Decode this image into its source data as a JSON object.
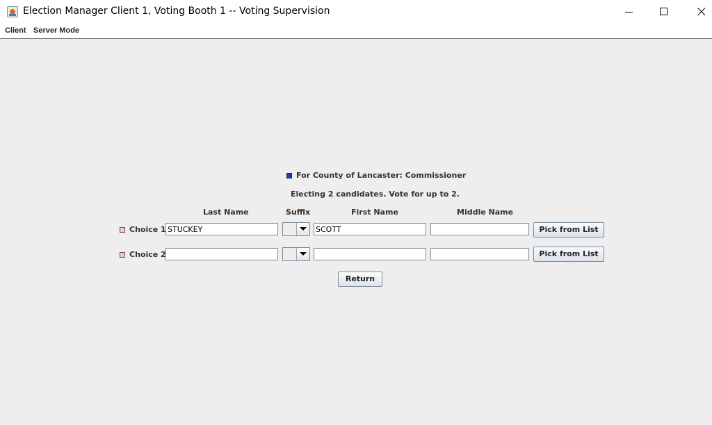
{
  "window": {
    "title": "Election Manager Client 1,  Voting Booth 1 -- Voting Supervision",
    "icon": "java-cup-icon",
    "controls": [
      "minimize-icon",
      "maximize-icon",
      "close-icon"
    ]
  },
  "menu": {
    "items": [
      {
        "label": "Client"
      },
      {
        "label": "Server Mode"
      }
    ]
  },
  "contest": {
    "title": "For County of Lancaster: Commissioner",
    "instructions": "Electing 2 candidates.   Vote for up to 2.",
    "marker_color": "#1f3fb4"
  },
  "columns": {
    "last_name": "Last Name",
    "suffix": "Suffix",
    "first_name": "First Name",
    "middle_name": "Middle Name"
  },
  "choices": [
    {
      "label": "Choice 1:",
      "last_name": "STUCKEY",
      "suffix": "",
      "first_name": "SCOTT",
      "middle_name": "",
      "pick_label": "Pick from List"
    },
    {
      "label": "Choice 2:",
      "last_name": "",
      "suffix": "",
      "first_name": "",
      "middle_name": "",
      "pick_label": "Pick from List"
    }
  ],
  "return_label": "Return",
  "colors": {
    "background": "#eeeeee",
    "choice_marker": "#f2c8c8"
  }
}
